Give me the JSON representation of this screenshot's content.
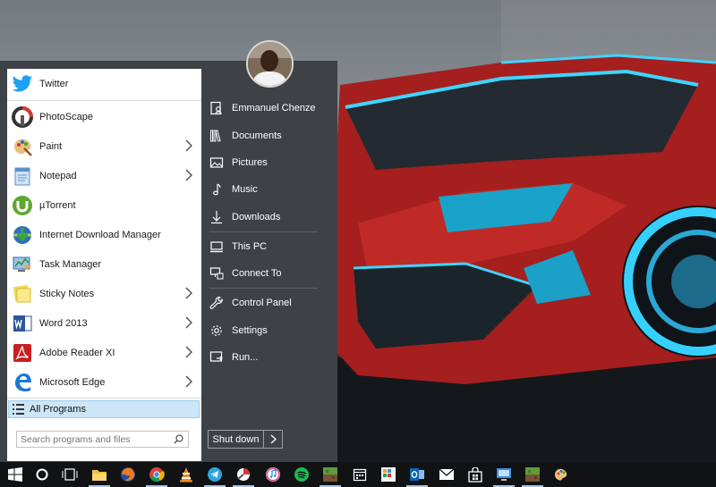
{
  "user": {
    "name": "Emmanuel Chenze"
  },
  "programs": [
    {
      "label": "Twitter",
      "icon": "twitter-icon",
      "color": "#1da1f2"
    },
    {
      "label": "PhotoScape",
      "icon": "photoscape-icon",
      "color": "#c0392b"
    },
    {
      "label": "Paint",
      "icon": "paint-icon",
      "color": "#e8b84a"
    },
    {
      "label": "Notepad",
      "icon": "notepad-icon",
      "color": "#5b8fc9"
    },
    {
      "label": "µTorrent",
      "icon": "utorrent-icon",
      "color": "#5ea72f"
    },
    {
      "label": "Internet Download Manager",
      "icon": "idm-icon",
      "color": "#2d8a3a"
    },
    {
      "label": "Task Manager",
      "icon": "task-manager-icon",
      "color": "#3b6ea5"
    },
    {
      "label": "Sticky Notes",
      "icon": "sticky-notes-icon",
      "color": "#f2d64a"
    },
    {
      "label": "Word 2013",
      "icon": "word-icon",
      "color": "#2b579a"
    },
    {
      "label": "Adobe Reader XI",
      "icon": "adobe-reader-icon",
      "color": "#c8201e"
    },
    {
      "label": "Microsoft Edge",
      "icon": "edge-icon",
      "color": "#1e78d2"
    }
  ],
  "all_programs": {
    "label": "All Programs"
  },
  "search": {
    "placeholder": "Search programs and files"
  },
  "places": [
    {
      "label": "Emmanuel Chenze",
      "icon": "user-folder-icon"
    },
    {
      "label": "Documents",
      "icon": "documents-icon"
    },
    {
      "label": "Pictures",
      "icon": "pictures-icon"
    },
    {
      "label": "Music",
      "icon": "music-icon"
    },
    {
      "label": "Downloads",
      "icon": "downloads-icon"
    },
    {
      "label": "This PC",
      "icon": "this-pc-icon"
    },
    {
      "label": "Connect To",
      "icon": "connect-to-icon"
    },
    {
      "label": "Control Panel",
      "icon": "control-panel-icon"
    },
    {
      "label": "Settings",
      "icon": "settings-gear-icon"
    },
    {
      "label": "Run...",
      "icon": "run-icon"
    }
  ],
  "shutdown": {
    "label": "Shut down"
  },
  "taskbar": {
    "items": [
      {
        "icon": "windows-start-icon"
      },
      {
        "icon": "cortana-icon"
      },
      {
        "icon": "task-view-icon"
      },
      {
        "icon": "file-explorer-icon"
      },
      {
        "icon": "firefox-icon"
      },
      {
        "icon": "chrome-icon"
      },
      {
        "icon": "vlc-icon"
      },
      {
        "icon": "telegram-icon"
      },
      {
        "icon": "photoscape-icon"
      },
      {
        "icon": "itunes-icon"
      },
      {
        "icon": "spotify-icon"
      },
      {
        "icon": "minecraft-icon"
      },
      {
        "icon": "calendar-icon"
      },
      {
        "icon": "apps-grid-icon"
      },
      {
        "icon": "outlook-icon"
      },
      {
        "icon": "mail-icon"
      },
      {
        "icon": "store-icon"
      },
      {
        "icon": "remote-desktop-icon"
      },
      {
        "icon": "minecraft-icon"
      },
      {
        "icon": "paint-icon"
      }
    ]
  }
}
